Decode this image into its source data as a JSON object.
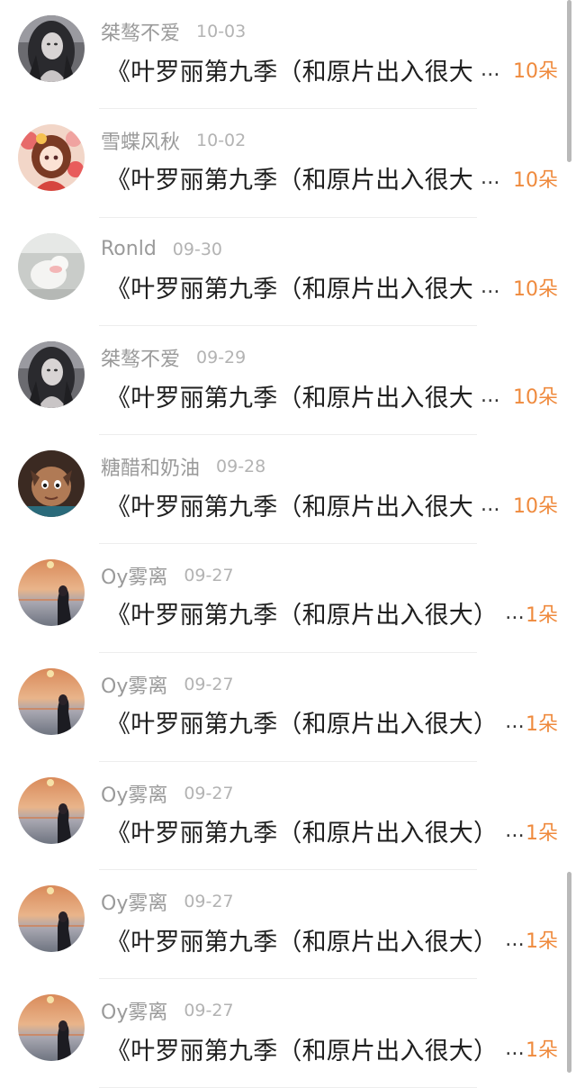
{
  "comments": [
    {
      "avatar": "avatar-gothic-girl",
      "username": "桀骜不爱",
      "date": "10-03",
      "message": "《叶罗丽第九季（和原片出入很大",
      "gift": "10朵"
    },
    {
      "avatar": "avatar-flower-girl",
      "username": "雪蝶风秋",
      "date": "10-02",
      "message": "《叶罗丽第九季（和原片出入很大",
      "gift": "10朵"
    },
    {
      "avatar": "avatar-white-cat",
      "username": "Ronld",
      "date": "09-30",
      "message": "《叶罗丽第九季（和原片出入很大",
      "gift": "10朵"
    },
    {
      "avatar": "avatar-gothic-girl",
      "username": "桀骜不爱",
      "date": "09-29",
      "message": "《叶罗丽第九季（和原片出入很大",
      "gift": "10朵"
    },
    {
      "avatar": "avatar-cartoon-character",
      "username": "糖醋和奶油",
      "date": "09-28",
      "message": "《叶罗丽第九季（和原片出入很大",
      "gift": "10朵"
    },
    {
      "avatar": "avatar-sunset-girl",
      "username": "Oy雾离",
      "date": "09-27",
      "message": "《叶罗丽第九季（和原片出入很大）",
      "gift": "1朵"
    },
    {
      "avatar": "avatar-sunset-girl",
      "username": "Oy雾离",
      "date": "09-27",
      "message": "《叶罗丽第九季（和原片出入很大）",
      "gift": "1朵"
    },
    {
      "avatar": "avatar-sunset-girl",
      "username": "Oy雾离",
      "date": "09-27",
      "message": "《叶罗丽第九季（和原片出入很大）",
      "gift": "1朵"
    },
    {
      "avatar": "avatar-sunset-girl",
      "username": "Oy雾离",
      "date": "09-27",
      "message": "《叶罗丽第九季（和原片出入很大）",
      "gift": "1朵"
    },
    {
      "avatar": "avatar-sunset-girl",
      "username": "Oy雾离",
      "date": "09-27",
      "message": "《叶罗丽第九季（和原片出入很大）",
      "gift": "1朵"
    }
  ],
  "ellipsis": "...",
  "colors": {
    "gift": "#ef8a3d",
    "username": "#9a9a9a",
    "date": "#b3b3b3",
    "message": "#1f1f1f"
  }
}
